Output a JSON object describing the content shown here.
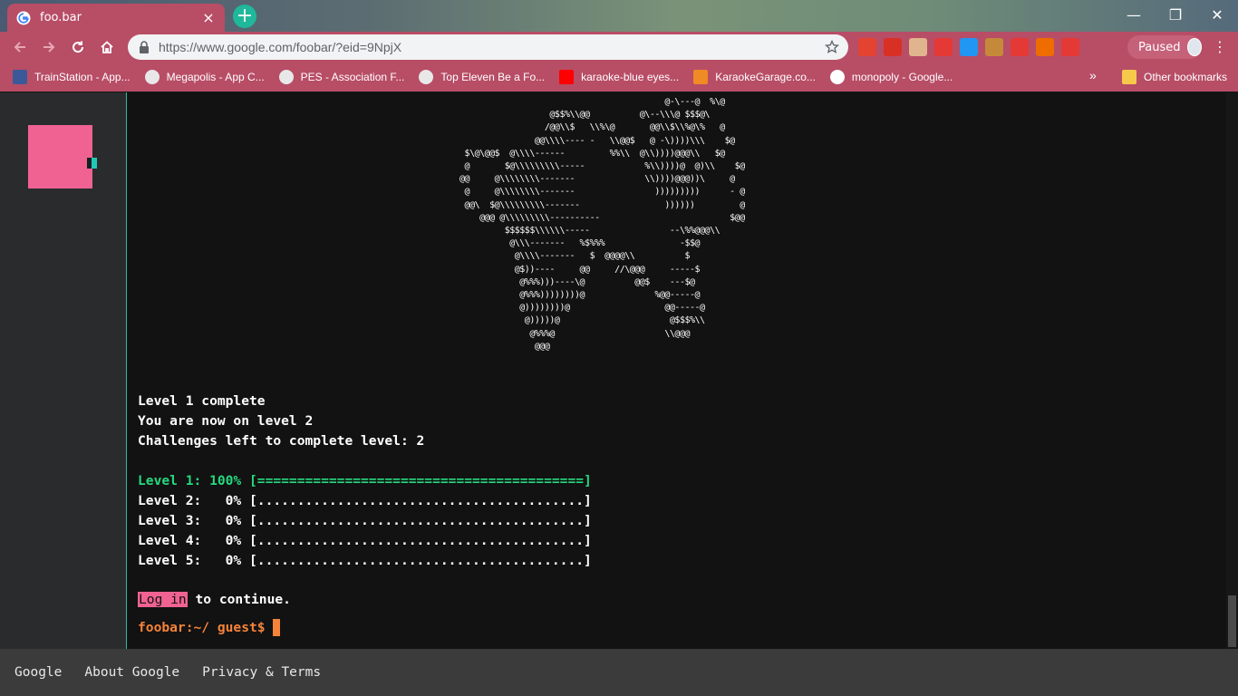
{
  "browser": {
    "tab": {
      "title": "foo.bar",
      "close_glyph": "×"
    },
    "new_tab_glyph": "+",
    "window_controls": {
      "minimize": "—",
      "restore": "❐",
      "close": "✕"
    },
    "url": "https://www.google.com/foobar/?eid=9NpjX",
    "profile_label": "Paused",
    "menu_glyph": "⋮",
    "extensions": [
      {
        "name": "todoist-icon",
        "color": "#e44332"
      },
      {
        "name": "bookmark-red-icon",
        "color": "#d93025"
      },
      {
        "name": "pixel-face-icon",
        "color": "#e0b58d"
      },
      {
        "name": "star-red-icon",
        "color": "#e53935"
      },
      {
        "name": "tff-icon",
        "color": "#2196f3"
      },
      {
        "name": "cookie-icon",
        "color": "#c48a3a"
      },
      {
        "name": "hand-stop-icon",
        "color": "#e53935"
      },
      {
        "name": "pumpkin-icon",
        "color": "#ef6c00"
      },
      {
        "name": "youtube-ext-icon",
        "color": "#e53935"
      }
    ],
    "bookmarks": [
      {
        "label": "TrainStation - App...",
        "icon": "facebook-icon",
        "color": "#3b5998"
      },
      {
        "label": "Megapolis - App C...",
        "icon": "globe-icon",
        "color": "#e8e8e8"
      },
      {
        "label": "PES - Association F...",
        "icon": "globe-icon",
        "color": "#e8e8e8"
      },
      {
        "label": "Top Eleven Be a Fo...",
        "icon": "globe-icon",
        "color": "#e8e8e8"
      },
      {
        "label": "karaoke-blue eyes...",
        "icon": "youtube-icon",
        "color": "#ff0000"
      },
      {
        "label": "KaraokeGarage.co...",
        "icon": "microphone-icon",
        "color": "#f08a24"
      },
      {
        "label": "monopoly - Google...",
        "icon": "google-icon",
        "color": "#ffffff"
      }
    ],
    "bookmarks_more": "»",
    "other_bookmarks": "Other bookmarks"
  },
  "ascii_art": [
    "                                           @-\\---@  %\\@",
    "                    @$$%\\\\@@          @\\--\\\\\\@ $$$@\\",
    "                   /@@\\\\$   \\\\%\\@       @@\\\\$\\\\%@\\%   @",
    "                 @@\\\\\\\\---- -   \\\\@@$   @ -\\))))\\\\\\    $@",
    "   $\\@\\@@$  @\\\\\\\\------         %%\\\\  @\\\\))))@@@\\\\   $@",
    "   @       $@\\\\\\\\\\\\\\\\\\-----            %\\\\))))@  @)\\\\    $@",
    "  @@     @\\\\\\\\\\\\\\\\-------              \\\\))))@@@))\\     @",
    "   @     @\\\\\\\\\\\\\\\\-------                )))))))))      - @",
    "   @@\\  $@\\\\\\\\\\\\\\\\\\-------                 ))))))         @",
    "      @@@ @\\\\\\\\\\\\\\\\\\----------                          $@@",
    "           $$$$$$\\\\\\\\\\\\-----                --\\%%@@@\\\\",
    "            @\\\\\\-------   %$%%%               -$$@",
    "             @\\\\\\\\-------   $  @@@@\\\\          $",
    "             @$))----     @@     //\\@@@     -----$",
    "              @%%%)))----\\@          @@$    ---$@",
    "              @%%%))))))))@              %@@-----@",
    "              @))))))))@                   @@-----@",
    "               @)))))@                      @$$$%\\\\",
    "                @%%%@                      \\\\@@@",
    "                 @@@"
  ],
  "terminal": {
    "lines": [
      {
        "text": "Level 1 complete",
        "style": "normal"
      },
      {
        "text": "You are now on level 2",
        "style": "normal"
      },
      {
        "text": "Challenges left to complete level: 2",
        "style": "normal"
      },
      {
        "text": "",
        "style": "normal"
      },
      {
        "text": "Level 1: 100% [=========================================]",
        "style": "green"
      },
      {
        "text": "Level 2:   0% [.........................................]",
        "style": "normal"
      },
      {
        "text": "Level 3:   0% [.........................................]",
        "style": "normal"
      },
      {
        "text": "Level 4:   0% [.........................................]",
        "style": "normal"
      },
      {
        "text": "Level 5:   0% [.........................................]",
        "style": "normal"
      }
    ],
    "login_link": "Log in",
    "login_suffix": " to continue.",
    "prompt": "foobar:~/ guest$"
  },
  "levels": [
    {
      "level": 1,
      "progress": 100
    },
    {
      "level": 2,
      "progress": 0
    },
    {
      "level": 3,
      "progress": 0
    },
    {
      "level": 4,
      "progress": 0
    },
    {
      "level": 5,
      "progress": 0
    }
  ],
  "footer": {
    "links": [
      "Google",
      "About Google",
      "Privacy & Terms"
    ]
  },
  "colors": {
    "accent_pink": "#f06292",
    "accent_teal": "#26c6b7",
    "success_green": "#26d97f",
    "prompt_orange": "#f5833a"
  }
}
